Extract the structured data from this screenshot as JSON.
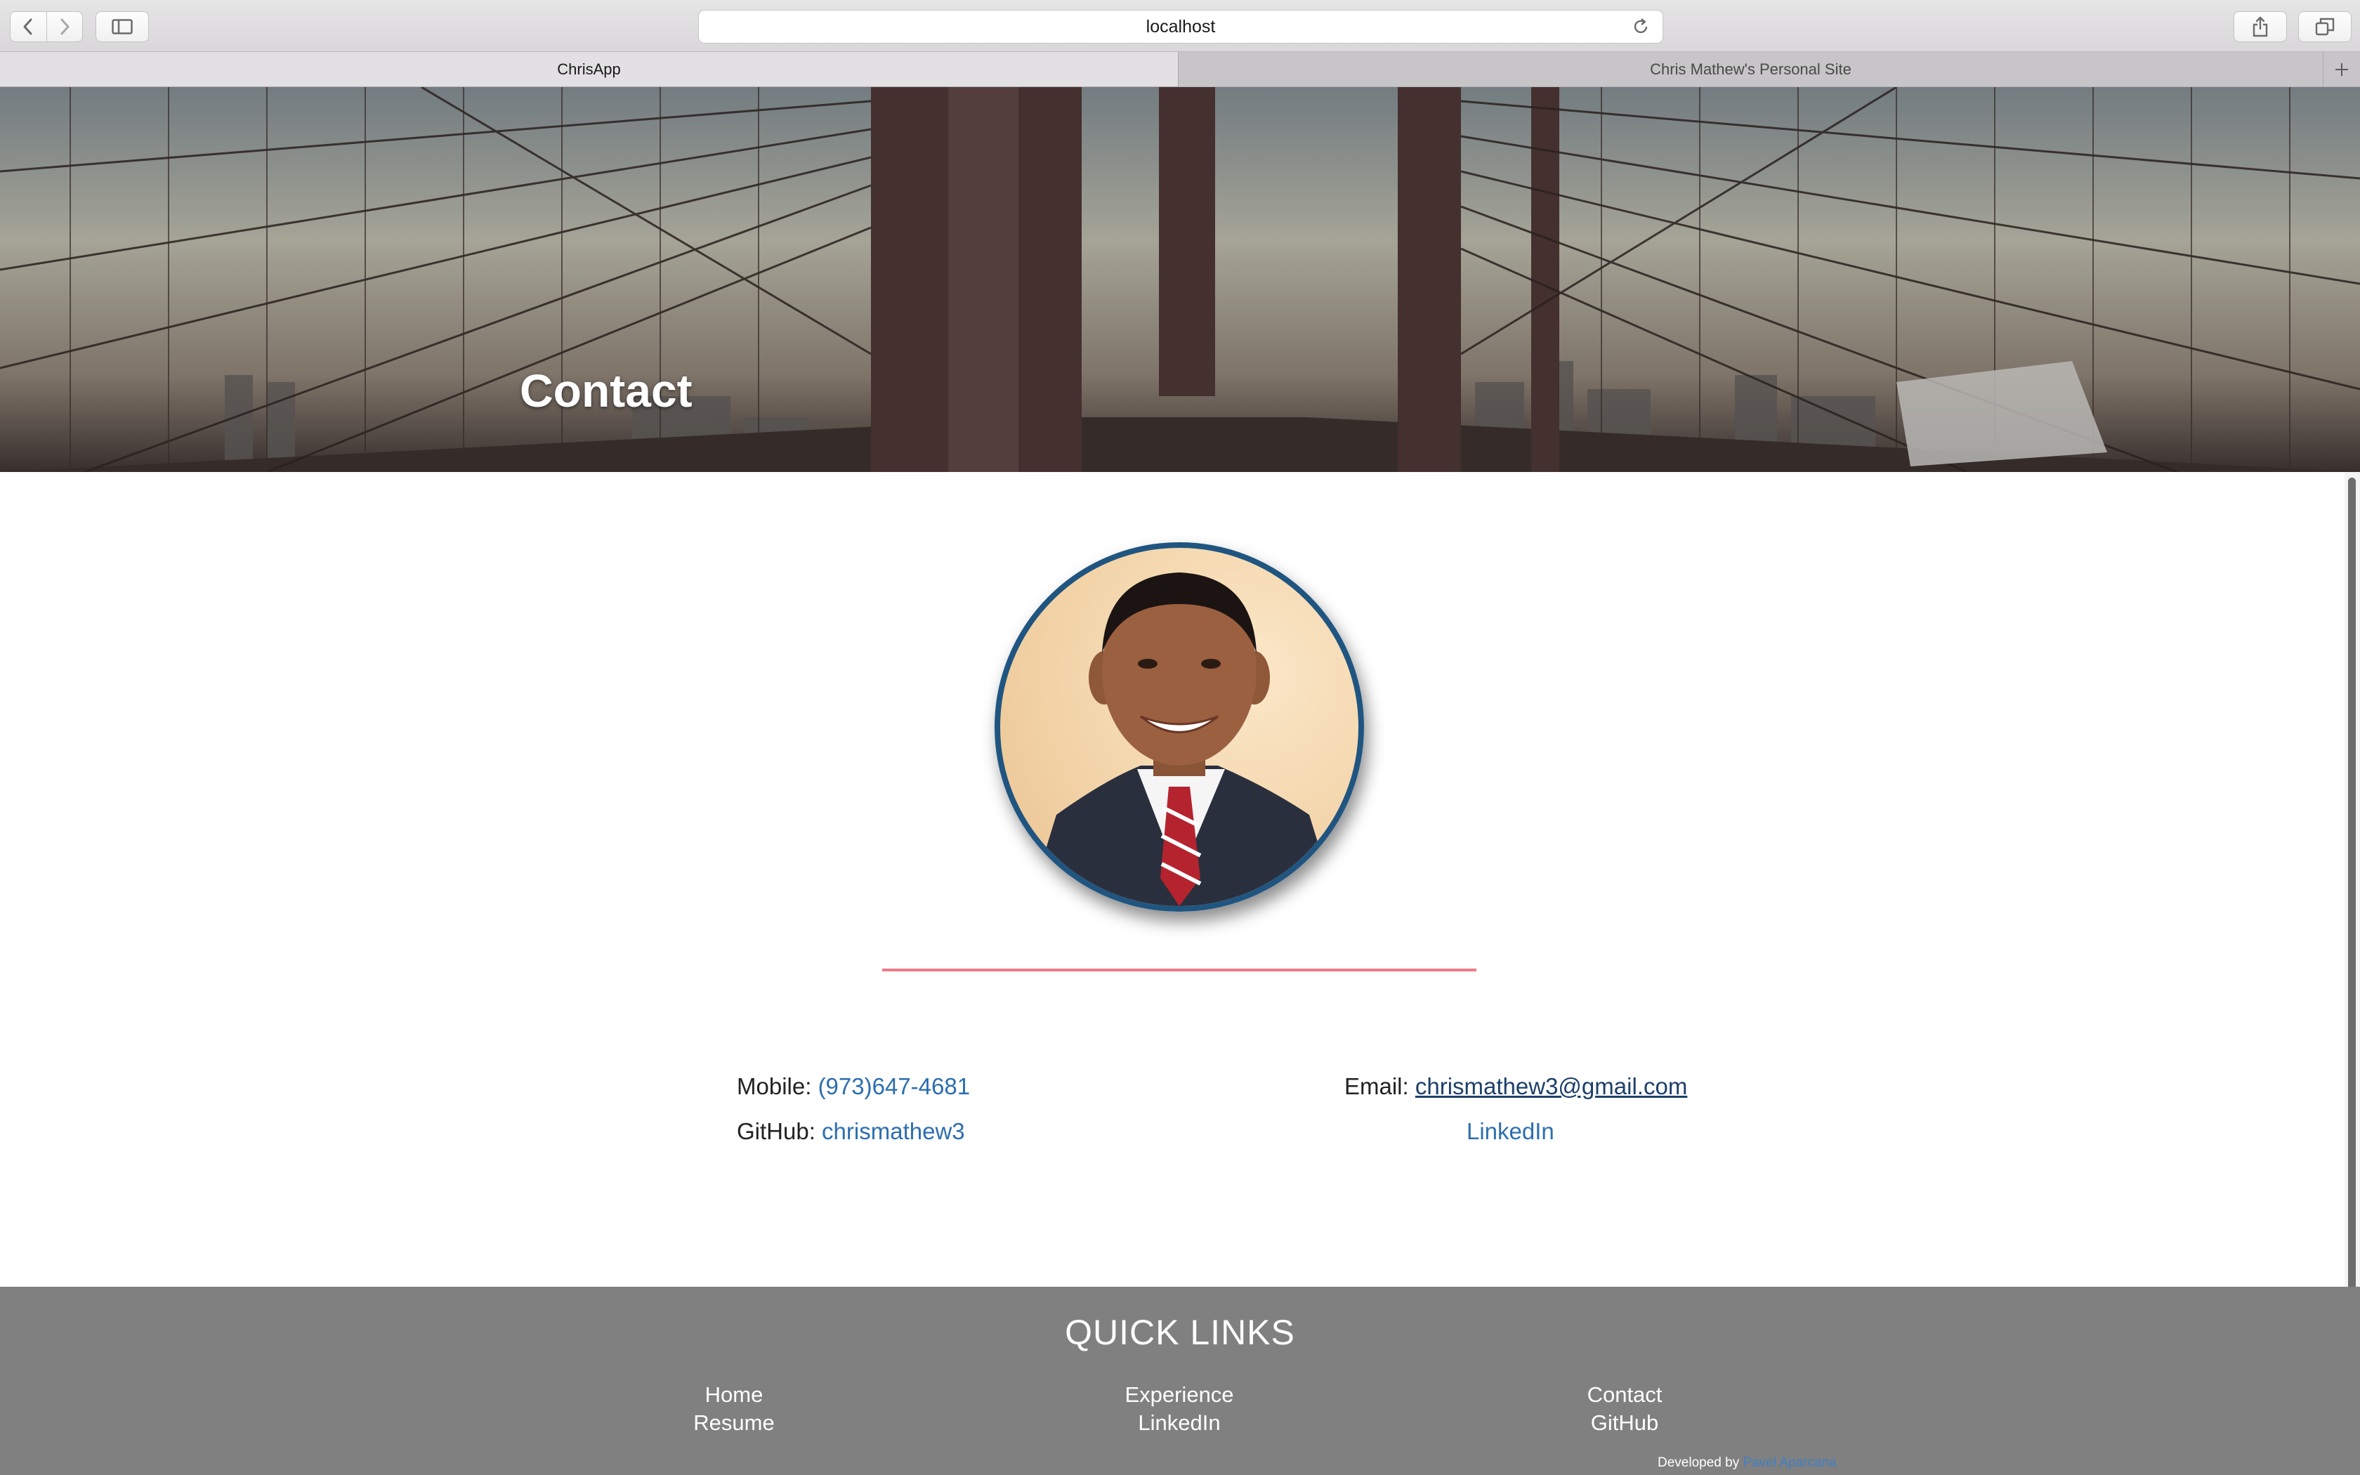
{
  "browser": {
    "address": "localhost",
    "tabs": [
      {
        "label": "ChrisApp",
        "active": true
      },
      {
        "label": "Chris Mathew's Personal Site",
        "active": false
      }
    ],
    "icons": {
      "back": "chevron-left-icon",
      "forward": "chevron-right-icon",
      "sidebar": "sidebar-icon",
      "reload": "reload-icon",
      "share": "share-icon",
      "tabs": "tabs-overview-icon",
      "new_tab": "plus-icon"
    }
  },
  "hero": {
    "title": "Contact"
  },
  "profile": {
    "avatar_border_color": "#1f5580",
    "divider_color": "#f27b86"
  },
  "contact": {
    "mobile_label": "Mobile:",
    "mobile_value": "(973)647-4681",
    "github_label": "GitHub:",
    "github_value": "chrismathew3",
    "email_label": "Email:",
    "email_value": "chrismathew3@gmail.com",
    "linkedin_label": "LinkedIn",
    "link_color": "#2c6eaf"
  },
  "footer": {
    "title": "QUICK LINKS",
    "columns": [
      [
        "Home",
        "Resume"
      ],
      [
        "Experience",
        "LinkedIn"
      ],
      [
        "Contact",
        "GitHub"
      ]
    ],
    "credit_prefix": "Developed by",
    "credit_name": "Pavel Aparcana",
    "background": "#808080"
  }
}
